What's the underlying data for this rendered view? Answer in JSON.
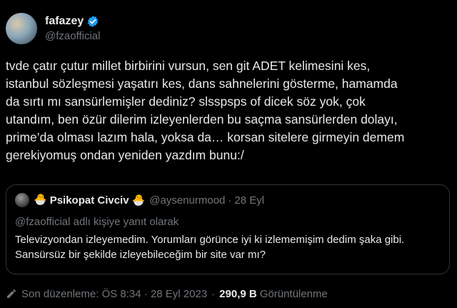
{
  "author": {
    "display_name": "fafazey",
    "handle": "@fzaofficial",
    "verified_icon": "verified-badge-icon",
    "accent": "#1d9bf0"
  },
  "tweet": {
    "text": "tvde çatır çutur millet birbirini vursun, sen git ADET kelimesini kes,\nistanbul sözleşmesi yaşatırı kes, dans sahnelerini gösterme, hamamda\nda sırtı mı sansürlemişler dediniz? slsspsps of dicek söz yok, çok\nutandım, ben özür dilerim izleyenlerden bu saçma sansürlerden dolayı,\nprime’da olması lazım hala, yoksa da… korsan sitelere girmeyin demem\ngerekiyomuş ondan yeniden yazdım bunu:/"
  },
  "quote": {
    "display_name": "Psikopat Civciv",
    "emoji_left": "🐣",
    "emoji_right": "🐣",
    "handle": "@aysenurmood",
    "separator": "·",
    "time": "28 Eyl",
    "reply_to": "@fzaofficial adlı kişiye yanıt olarak",
    "text": "Televizyondan izleyemedim. Yorumları görünce iyi ki izlememişim dedim şaka gibi. Sansürsüz bir şekilde izleyebileceğim bir site var mı?"
  },
  "meta": {
    "edit_icon": "edit-pencil-icon",
    "last_edited": "Son düzenleme: ÖS 8:34 · 28 Eyl 2023",
    "separator": "·",
    "views_count": "290,9 B",
    "views_label": "Görüntülenme"
  },
  "colors": {
    "background": "#000000",
    "text": "#e7e9ea",
    "muted": "#71767b",
    "border": "#2f3336"
  }
}
